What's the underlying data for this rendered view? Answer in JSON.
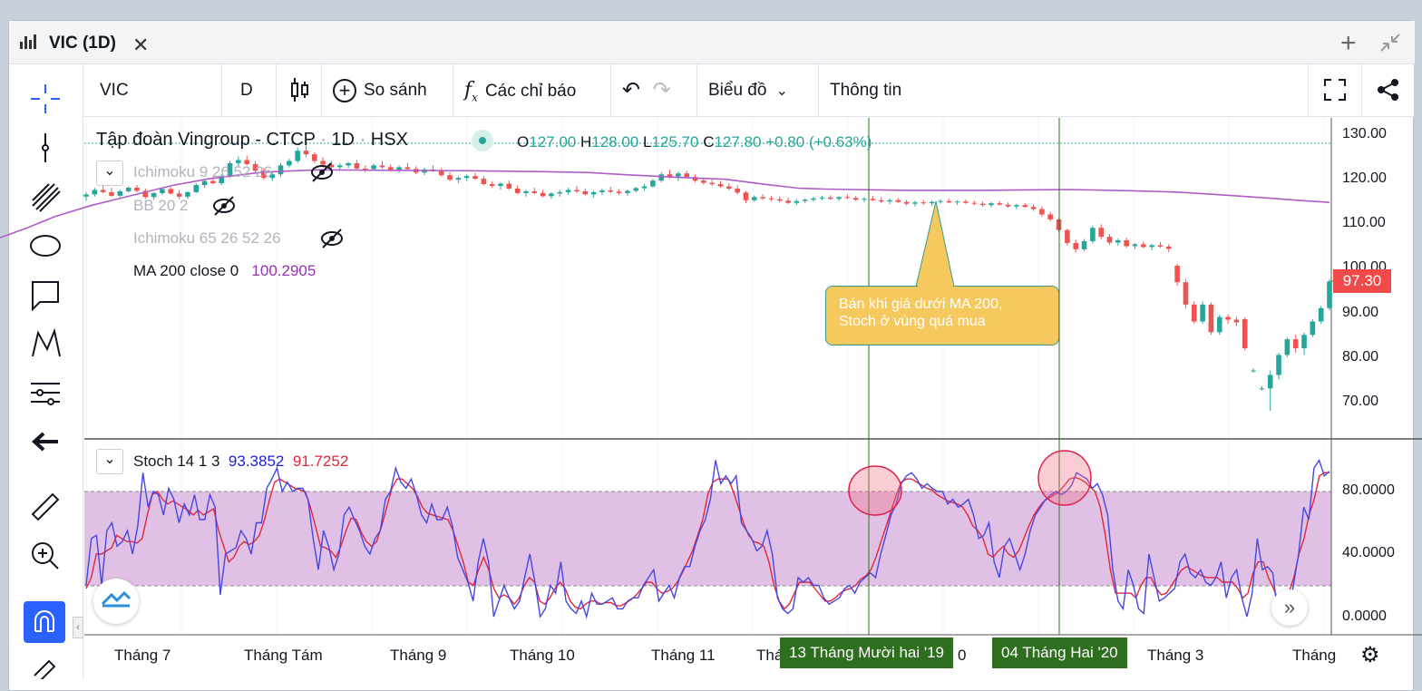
{
  "window": {
    "title": "VIC (1D)"
  },
  "toolbar": {
    "symbol": "VIC",
    "interval": "D",
    "compare": "So sánh",
    "indicators": "Các chỉ báo",
    "chart_type": "Biểu đồ",
    "info": "Thông tin"
  },
  "legend": {
    "name": "Tập đoàn Vingroup - CTCP",
    "sep1": "·",
    "interval": "1D",
    "sep2": "·",
    "exchange": "HSX",
    "open_label": "O",
    "open": "127.00",
    "high_label": "H",
    "high": "128.00",
    "low_label": "L",
    "low": "125.70",
    "close_label": "C",
    "close": "127.80",
    "change": "+0.80 (+0.63%)"
  },
  "indicators": [
    {
      "name": "Ichimoku 9 26 52 26"
    },
    {
      "name": "BB 20 2"
    },
    {
      "name": "Ichimoku 65 26 52 26"
    },
    {
      "name": "MA 200 close 0",
      "value": "100.2905"
    }
  ],
  "stoch": {
    "name": "Stoch 14 1 3",
    "k": "93.3852",
    "d": "91.7252"
  },
  "annotation": {
    "line1": "Bán khi giá dưới MA 200,",
    "line2": "Stoch ở vùng quá mua"
  },
  "price_axis": [
    "130.00",
    "120.00",
    "110.00",
    "100.00",
    "90.00",
    "80.00",
    "70.00"
  ],
  "last_price": "97.30",
  "stoch_axis": [
    "80.0000",
    "40.0000",
    "0.0000"
  ],
  "time_axis": [
    "Tháng 7",
    "Tháng Tám",
    "Tháng 9",
    "Tháng 10",
    "Tháng 11",
    "Thá",
    "0",
    "Tháng 3",
    "Tháng"
  ],
  "crosshair_dates": [
    "13 Tháng Mười hai '19",
    "04 Tháng Hai '20"
  ],
  "colors": {
    "up": "#26a69a",
    "down": "#ef5350",
    "ma": "#b05cc8",
    "stoch_k": "#4646e0",
    "stoch_d": "#e0283a",
    "band": "#dbb6e0",
    "vline": "#2e6e1f"
  },
  "chart_data": {
    "type": "candlestick",
    "price_range": [
      65,
      132
    ],
    "stoch_range": [
      0,
      100
    ],
    "stoch_band": [
      20,
      80
    ],
    "candles": [
      [
        116,
        117,
        115,
        116.5
      ],
      [
        116.5,
        118,
        116,
        117.5
      ],
      [
        117.5,
        118.5,
        116.8,
        117
      ],
      [
        117,
        118,
        116,
        116.2
      ],
      [
        116.2,
        117.5,
        115.8,
        117.2
      ],
      [
        117.2,
        118.3,
        116.9,
        118
      ],
      [
        118,
        118.6,
        117,
        117.3
      ],
      [
        117.3,
        117.8,
        115.5,
        115.9
      ],
      [
        115.9,
        117,
        115.3,
        116.8
      ],
      [
        116.8,
        118,
        116.4,
        117.7
      ],
      [
        117.7,
        118.2,
        116.5,
        116.7
      ],
      [
        116.7,
        117.5,
        115.5,
        116
      ],
      [
        116,
        117.2,
        115.5,
        117
      ],
      [
        117,
        119,
        116.8,
        118.6
      ],
      [
        118.6,
        120,
        118,
        119.5
      ],
      [
        119.5,
        120.5,
        118.8,
        119
      ],
      [
        119,
        121,
        118.6,
        120.6
      ],
      [
        120.6,
        124,
        120.2,
        123.5
      ],
      [
        123.5,
        125,
        122.8,
        124.2
      ],
      [
        124.2,
        125.2,
        123,
        123.3
      ],
      [
        123.3,
        124,
        121.2,
        121.8
      ],
      [
        121.8,
        122.5,
        119.8,
        120.2
      ],
      [
        120.2,
        121.5,
        119.5,
        121
      ],
      [
        121,
        123.5,
        120.5,
        123
      ],
      [
        123,
        124.5,
        122.5,
        124
      ],
      [
        124,
        127,
        123.5,
        126.3
      ],
      [
        126.3,
        127.5,
        125,
        125.5
      ],
      [
        125.5,
        126,
        123.5,
        124
      ],
      [
        124,
        124.8,
        122.5,
        123.2
      ],
      [
        123.2,
        124,
        122,
        122.6
      ],
      [
        122.6,
        123.5,
        121.8,
        123
      ],
      [
        123,
        123.8,
        122.4,
        123.5
      ],
      [
        123.5,
        124.2,
        122,
        122.3
      ],
      [
        122.3,
        123,
        121.5,
        122.2
      ],
      [
        122.2,
        123.4,
        121.8,
        123
      ],
      [
        123,
        124,
        122.3,
        122.6
      ],
      [
        122.6,
        123.2,
        121.6,
        121.8
      ],
      [
        121.8,
        123,
        121.4,
        122.6
      ],
      [
        122.6,
        123.6,
        122,
        122.2
      ],
      [
        122.2,
        122.8,
        121,
        121.4
      ],
      [
        121.4,
        122.5,
        120.8,
        122.1
      ],
      [
        122.1,
        123,
        121.5,
        121.8
      ],
      [
        121.8,
        122.4,
        120.5,
        120.8
      ],
      [
        120.8,
        121.5,
        119.5,
        119.8
      ],
      [
        119.8,
        120.6,
        119,
        120.2
      ],
      [
        120.2,
        121,
        119.5,
        120.6
      ],
      [
        120.6,
        121.3,
        119.8,
        120
      ],
      [
        120,
        120.6,
        118.5,
        118.8
      ],
      [
        118.8,
        119.5,
        118,
        118.4
      ],
      [
        118.4,
        119.2,
        117.6,
        118.9
      ],
      [
        118.9,
        119.6,
        117.5,
        117.8
      ],
      [
        117.8,
        118.5,
        116.5,
        116.8
      ],
      [
        116.8,
        117.6,
        116,
        117.2
      ],
      [
        117.2,
        118,
        116.5,
        116.8
      ],
      [
        116.8,
        117.5,
        115.8,
        116.1
      ],
      [
        116.1,
        117,
        115.5,
        116.7
      ],
      [
        116.7,
        117.5,
        116,
        117
      ],
      [
        117,
        118,
        116.4,
        117.5
      ],
      [
        117.5,
        118.4,
        116.8,
        117.2
      ],
      [
        117.2,
        117.8,
        116.3,
        116.5
      ],
      [
        116.5,
        117.3,
        115.8,
        117
      ],
      [
        117,
        117.8,
        116.4,
        117.4
      ],
      [
        117.4,
        118.2,
        116.8,
        117.1
      ],
      [
        117.1,
        117.7,
        116.4,
        116.8
      ],
      [
        116.8,
        117.6,
        116.2,
        117.3
      ],
      [
        117.3,
        118.2,
        116.9,
        117.9
      ],
      [
        117.9,
        118.8,
        117.3,
        118.3
      ],
      [
        118.3,
        120,
        118,
        119.6
      ],
      [
        119.6,
        121.5,
        119.2,
        121
      ],
      [
        121,
        122,
        120,
        120.5
      ],
      [
        120.5,
        121.6,
        119.5,
        121.2
      ],
      [
        121.2,
        121.8,
        120.2,
        120.4
      ],
      [
        120.4,
        121,
        119.2,
        119.6
      ],
      [
        119.6,
        120.3,
        118.7,
        119.1
      ],
      [
        119.1,
        119.8,
        118.4,
        118.8
      ],
      [
        118.8,
        119.5,
        118,
        118.3
      ],
      [
        118.3,
        119,
        117.4,
        117.8
      ],
      [
        117.8,
        118.5,
        116.5,
        116.9
      ],
      [
        116.9,
        117.3,
        114.5,
        115.2
      ],
      [
        115.2,
        116.3,
        114.8,
        115.9
      ],
      [
        115.9,
        116.6,
        115.3,
        115.6
      ],
      [
        115.6,
        116.2,
        115,
        115.4
      ],
      [
        115.4,
        116,
        114.7,
        115.1
      ],
      [
        115.1,
        115.8,
        114.3,
        114.6
      ],
      [
        114.6,
        115.4,
        114.1,
        115
      ],
      [
        115,
        115.6,
        114.5,
        115.3
      ],
      [
        115.3,
        116,
        114.9,
        115.6
      ],
      [
        115.6,
        116.2,
        115.2,
        115.8
      ],
      [
        115.8,
        116.3,
        115.3,
        115.5
      ],
      [
        115.5,
        116.1,
        115,
        115.9
      ],
      [
        115.9,
        116.5,
        115.4,
        115.7
      ],
      [
        115.7,
        116.2,
        115,
        115.3
      ],
      [
        115.3,
        115.9,
        114.7,
        115.5
      ],
      [
        115.5,
        116.1,
        115,
        115.2
      ],
      [
        115.2,
        115.8,
        114.5,
        114.9
      ],
      [
        114.9,
        115.6,
        114.3,
        115.2
      ],
      [
        115.2,
        115.7,
        114.6,
        114.8
      ],
      [
        114.8,
        115.3,
        114,
        114.4
      ],
      [
        114.4,
        115.1,
        113.8,
        114.7
      ],
      [
        114.7,
        115.2,
        114.2,
        114.5
      ],
      [
        114.5,
        115.1,
        113.9,
        114.8
      ],
      [
        114.8,
        115.4,
        114.4,
        115
      ],
      [
        115,
        115.5,
        114.5,
        114.7
      ],
      [
        114.7,
        115.2,
        114.1,
        114.9
      ],
      [
        114.9,
        115.4,
        114.4,
        114.6
      ],
      [
        114.6,
        115.1,
        114,
        114.4
      ],
      [
        114.4,
        114.9,
        113.7,
        114.1
      ],
      [
        114.1,
        114.8,
        113.6,
        114.5
      ],
      [
        114.5,
        115,
        114,
        114.2
      ],
      [
        114.2,
        114.7,
        113.5,
        113.8
      ],
      [
        113.8,
        114.4,
        113.2,
        114.1
      ],
      [
        114.1,
        114.6,
        113.5,
        113.7
      ],
      [
        113.7,
        114.2,
        112.8,
        113.2
      ],
      [
        113.2,
        113.8,
        111.5,
        112
      ],
      [
        112,
        112.6,
        110.5,
        110.9
      ],
      [
        110.9,
        111.2,
        108,
        108.5
      ],
      [
        108.5,
        108.8,
        105,
        105.6
      ],
      [
        105.6,
        106.3,
        103.5,
        104.2
      ],
      [
        104.2,
        106.5,
        103.8,
        106
      ],
      [
        106,
        109.5,
        105.5,
        109
      ],
      [
        109,
        109.8,
        106.5,
        107
      ],
      [
        107,
        107.6,
        105.2,
        105.7
      ],
      [
        105.7,
        106.6,
        105,
        106.2
      ],
      [
        106.2,
        106.8,
        104.5,
        104.9
      ],
      [
        104.9,
        105.6,
        104.2,
        105.3
      ],
      [
        105.3,
        105.9,
        104.4,
        104.7
      ],
      [
        104.7,
        105.4,
        104,
        105.1
      ],
      [
        105.1,
        105.8,
        104.5,
        104.8
      ],
      [
        104.8,
        105.3,
        103.5,
        104.3
      ],
      [
        100.5,
        101,
        96,
        96.8
      ],
      [
        96.8,
        97.5,
        91,
        91.8
      ],
      [
        91.8,
        92.5,
        87.5,
        88
      ],
      [
        88,
        92.5,
        87.5,
        91.8
      ],
      [
        91.8,
        92.3,
        85,
        85.6
      ],
      [
        85.6,
        89.5,
        85,
        89
      ],
      [
        89,
        89.6,
        87.5,
        88.4
      ],
      [
        88.4,
        89,
        87,
        87.8
      ],
      [
        88.5,
        88.9,
        81.5,
        82
      ],
      [
        77,
        77.5,
        76.5,
        77
      ],
      [
        73,
        73.5,
        72.5,
        73
      ],
      [
        73,
        77,
        68,
        76
      ],
      [
        76,
        81,
        75,
        80.5
      ],
      [
        80.5,
        84.5,
        80,
        84
      ],
      [
        84,
        85,
        81,
        82
      ],
      [
        82,
        85.5,
        80.5,
        85
      ],
      [
        85,
        88.5,
        84.5,
        88
      ],
      [
        88,
        91.5,
        87.5,
        91
      ],
      [
        91,
        97.5,
        90.5,
        97
      ]
    ],
    "ma200": [
      [
        0,
        106.8
      ],
      [
        30,
        109
      ],
      [
        60,
        111.5
      ],
      [
        100,
        114
      ],
      [
        150,
        116.5
      ],
      [
        190,
        118.5
      ],
      [
        230,
        120
      ],
      [
        290,
        121.5
      ],
      [
        350,
        122
      ],
      [
        430,
        121.9
      ],
      [
        520,
        121.8
      ],
      [
        600,
        121.6
      ],
      [
        650,
        121.4
      ],
      [
        690,
        120.9
      ],
      [
        750,
        120.3
      ],
      [
        800,
        119.9
      ],
      [
        842,
        118.8
      ],
      [
        880,
        117.9
      ],
      [
        910,
        117.7
      ],
      [
        1000,
        117.4
      ],
      [
        1080,
        117.4
      ],
      [
        1180,
        117.6
      ],
      [
        1250,
        117.3
      ],
      [
        1300,
        117
      ],
      [
        1340,
        116.5
      ],
      [
        1390,
        115.8
      ],
      [
        1430,
        115.2
      ],
      [
        1466,
        114.7
      ]
    ],
    "stoch_k": [
      20,
      50,
      52,
      20,
      55,
      60,
      45,
      48,
      55,
      40,
      58,
      92,
      70,
      80,
      78,
      65,
      82,
      75,
      60,
      72,
      65,
      78,
      62,
      62,
      78,
      70,
      14,
      40,
      42,
      44,
      55,
      50,
      40,
      60,
      60,
      82,
      88,
      95,
      80,
      86,
      80,
      82,
      82,
      75,
      50,
      30,
      55,
      45,
      30,
      40,
      65,
      70,
      62,
      55,
      45,
      40,
      50,
      55,
      75,
      80,
      95,
      86,
      82,
      88,
      78,
      65,
      60,
      72,
      62,
      62,
      70,
      58,
      38,
      30,
      22,
      10,
      35,
      50,
      35,
      0,
      10,
      20,
      12,
      5,
      10,
      25,
      40,
      22,
      0,
      5,
      20,
      15,
      35,
      10,
      5,
      2,
      10,
      0,
      15,
      8,
      8,
      10,
      12,
      5,
      5,
      10,
      12,
      12,
      20,
      25,
      30,
      10,
      15,
      20,
      12,
      25,
      32,
      32,
      45,
      55,
      62,
      75,
      100,
      85,
      90,
      85,
      90,
      60,
      55,
      50,
      42,
      45,
      55,
      40,
      12,
      5,
      2,
      5,
      25,
      22,
      25,
      20,
      20,
      12,
      8,
      10,
      12,
      18,
      20,
      15,
      22,
      25,
      28,
      25,
      40,
      52,
      65,
      72,
      85,
      90,
      92,
      88,
      82,
      85,
      82,
      80,
      80,
      72,
      75,
      70,
      72,
      75,
      65,
      50,
      52,
      60,
      35,
      25,
      45,
      50,
      40,
      30,
      40,
      55,
      65,
      70,
      75,
      78,
      80,
      78,
      80,
      84,
      92,
      90,
      88,
      82,
      85,
      78,
      65,
      30,
      10,
      5,
      30,
      20,
      5,
      2,
      40,
      25,
      10,
      12,
      15,
      18,
      35,
      40,
      28,
      25,
      30,
      22,
      20,
      25,
      35,
      12,
      25,
      30,
      12,
      0,
      15,
      50,
      30,
      32,
      28,
      2,
      2,
      2,
      20,
      40,
      70,
      62,
      95,
      100,
      90,
      93
    ],
    "stoch_d": [
      18,
      25,
      40,
      40,
      42,
      44,
      52,
      50,
      48,
      48,
      47,
      50,
      65,
      78,
      80,
      75,
      72,
      74,
      72,
      70,
      68,
      65,
      68,
      65,
      67,
      69,
      55,
      45,
      35,
      38,
      45,
      48,
      46,
      48,
      52,
      62,
      75,
      86,
      88,
      86,
      84,
      82,
      81,
      80,
      70,
      58,
      45,
      44,
      42,
      38,
      45,
      55,
      63,
      62,
      54,
      48,
      45,
      48,
      58,
      70,
      82,
      88,
      88,
      85,
      82,
      77,
      70,
      66,
      65,
      64,
      63,
      62,
      55,
      45,
      35,
      22,
      20,
      30,
      38,
      30,
      18,
      12,
      14,
      12,
      8,
      12,
      20,
      25,
      22,
      10,
      8,
      12,
      18,
      22,
      18,
      10,
      6,
      5,
      8,
      10,
      10,
      8,
      9,
      9,
      7,
      7,
      9,
      11,
      14,
      18,
      22,
      22,
      18,
      15,
      16,
      18,
      22,
      28,
      35,
      42,
      52,
      62,
      78,
      86,
      88,
      88,
      88,
      80,
      70,
      60,
      52,
      48,
      47,
      45,
      35,
      20,
      10,
      5,
      8,
      15,
      22,
      22,
      22,
      18,
      14,
      10,
      10,
      12,
      15,
      17,
      18,
      20,
      24,
      26,
      30,
      38,
      48,
      58,
      68,
      78,
      86,
      88,
      88,
      86,
      84,
      82,
      81,
      78,
      76,
      74,
      73,
      72,
      70,
      65,
      58,
      55,
      50,
      40,
      38,
      42,
      45,
      40,
      38,
      42,
      50,
      58,
      65,
      70,
      74,
      76,
      78,
      80,
      84,
      88,
      89,
      88,
      86,
      83,
      80,
      70,
      52,
      30,
      15,
      15,
      15,
      15,
      12,
      20,
      25,
      25,
      18,
      14,
      15,
      20,
      25,
      30,
      32,
      30,
      28,
      26,
      25,
      25,
      25,
      22,
      22,
      22,
      18,
      12,
      15,
      28,
      35,
      35,
      25,
      18,
      10,
      10,
      15,
      25,
      40,
      50,
      65,
      75,
      90,
      92,
      92
    ]
  }
}
